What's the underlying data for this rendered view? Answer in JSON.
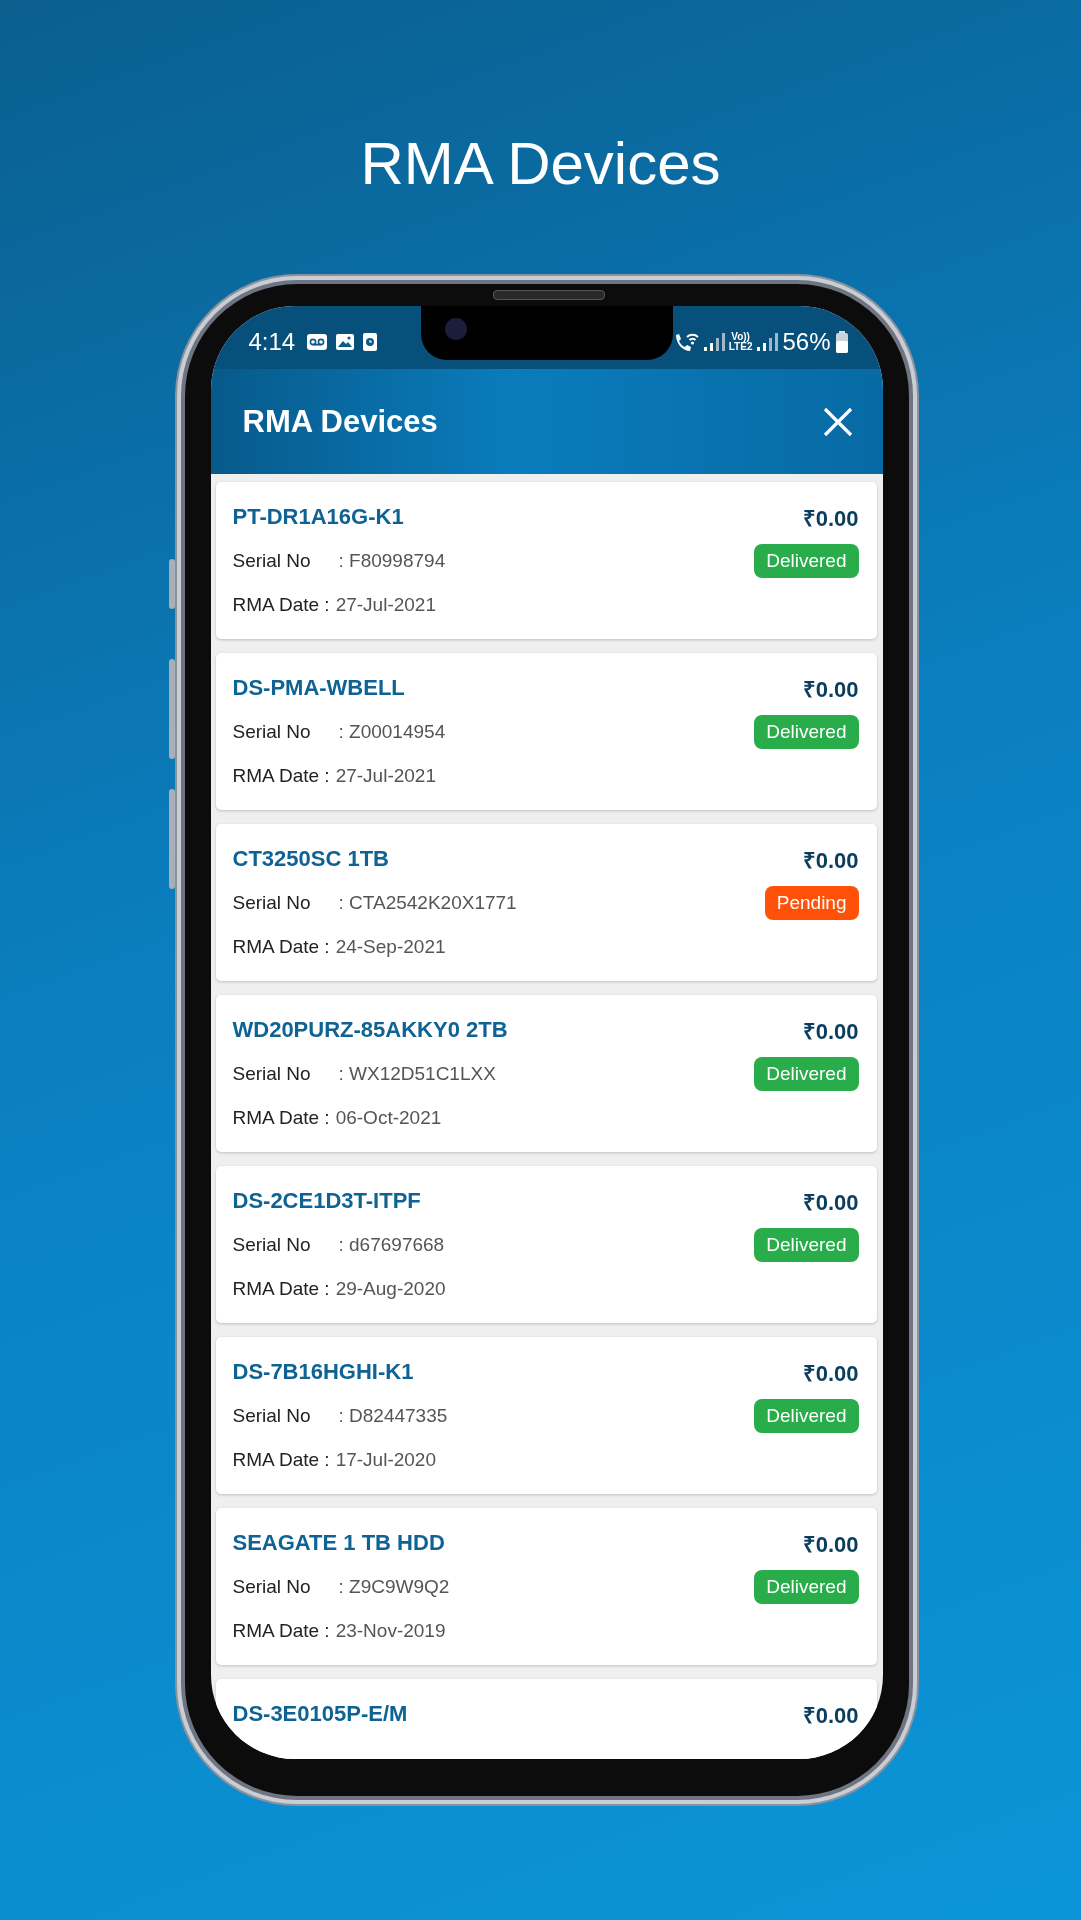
{
  "page_title": "RMA Devices",
  "status_bar": {
    "time": "4:14",
    "network_label_top": "Vo))",
    "network_label_bottom": "LTE2",
    "battery": "56%"
  },
  "header": {
    "title": "RMA Devices"
  },
  "devices": [
    {
      "name": "PT-DR1A16G-K1",
      "price": "₹0.00",
      "serial_label": "Serial No",
      "serial": ": F80998794",
      "date_label": "RMA Date :",
      "date": "27-Jul-2021",
      "status": {
        "kind": "delivered",
        "label": "Delivered"
      }
    },
    {
      "name": "DS-PMA-WBELL",
      "price": "₹0.00",
      "serial_label": "Serial No",
      "serial": ": Z00014954",
      "date_label": "RMA Date :",
      "date": "27-Jul-2021",
      "status": {
        "kind": "delivered",
        "label": "Delivered"
      }
    },
    {
      "name": "CT3250SC 1TB",
      "price": "₹0.00",
      "serial_label": "Serial No",
      "serial": ": CTA2542K20X1771",
      "date_label": "RMA Date :",
      "date": "24-Sep-2021",
      "status": {
        "kind": "pending",
        "label": "Pending"
      }
    },
    {
      "name": "WD20PURZ-85AKKY0 2TB",
      "price": "₹0.00",
      "serial_label": "Serial No",
      "serial": ": WX12D51C1LXX",
      "date_label": "RMA Date :",
      "date": "06-Oct-2021",
      "status": {
        "kind": "delivered",
        "label": "Delivered"
      }
    },
    {
      "name": "DS-2CE1D3T-ITPF",
      "price": "₹0.00",
      "serial_label": "Serial No",
      "serial": ": d67697668",
      "date_label": "RMA Date :",
      "date": "29-Aug-2020",
      "status": {
        "kind": "delivered",
        "label": "Delivered"
      }
    },
    {
      "name": "DS-7B16HGHI-K1",
      "price": "₹0.00",
      "serial_label": "Serial No",
      "serial": ": D82447335",
      "date_label": "RMA Date :",
      "date": "17-Jul-2020",
      "status": {
        "kind": "delivered",
        "label": "Delivered"
      }
    },
    {
      "name": "SEAGATE 1 TB HDD",
      "price": "₹0.00",
      "serial_label": "Serial No",
      "serial": ": Z9C9W9Q2",
      "date_label": "RMA Date :",
      "date": "23-Nov-2019",
      "status": {
        "kind": "delivered",
        "label": "Delivered"
      }
    },
    {
      "name": "DS-3E0105P-E/M",
      "price": "₹0.00"
    }
  ]
}
